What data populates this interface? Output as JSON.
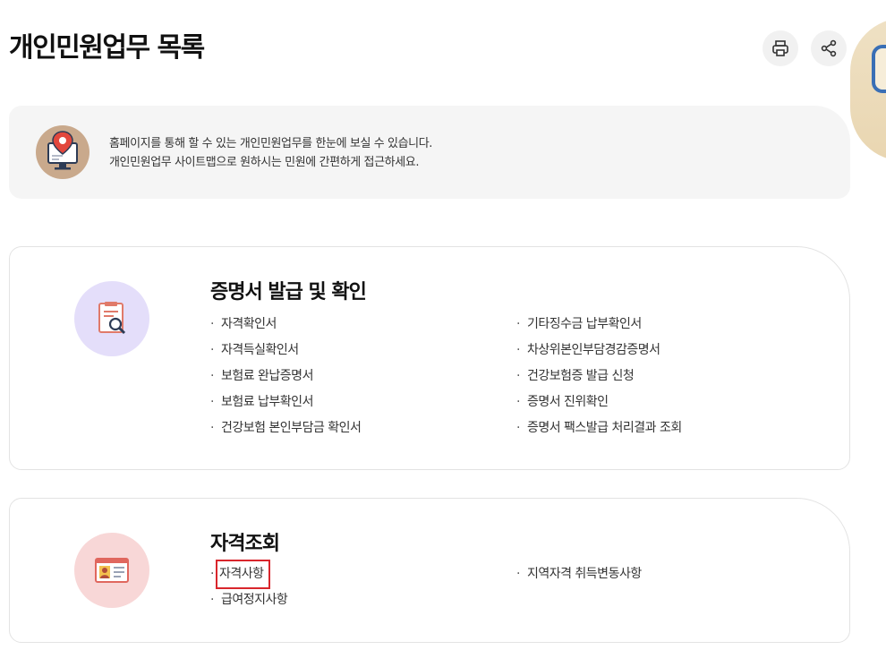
{
  "header": {
    "title": "개인민원업무 목록"
  },
  "intro": {
    "line1": "홈페이지를 통해 할 수 있는 개인민원업무를 한눈에 보실 수 있습니다.",
    "line2": "개인민원업무 사이트맵으로 원하시는 민원에 간편하게 접근하세요."
  },
  "sections": {
    "certificates": {
      "title": "증명서 발급 및 확인",
      "left": [
        "자격확인서",
        "자격득실확인서",
        "보험료 완납증명서",
        "보험료 납부확인서",
        "건강보험 본인부담금 확인서"
      ],
      "right": [
        "기타징수금 납부확인서",
        "차상위본인부담경감증명서",
        "건강보험증 발급 신청",
        "증명서 진위확인",
        "증명서 팩스발급 처리결과 조회"
      ]
    },
    "qualification": {
      "title": "자격조회",
      "left": [
        "자격사항",
        "급여정지사항"
      ],
      "right": [
        "지역자격 취득변동사항"
      ]
    }
  },
  "icons": {
    "print": "print-icon",
    "share": "share-icon",
    "intro": "monitor-location-icon",
    "certificates": "document-search-icon",
    "qualification": "id-card-icon"
  },
  "colors": {
    "highlight": "#d9262c",
    "cert_icon_bg": "#e4defa",
    "qual_icon_bg": "#f8d7d7",
    "intro_bg": "#f5f5f5"
  }
}
